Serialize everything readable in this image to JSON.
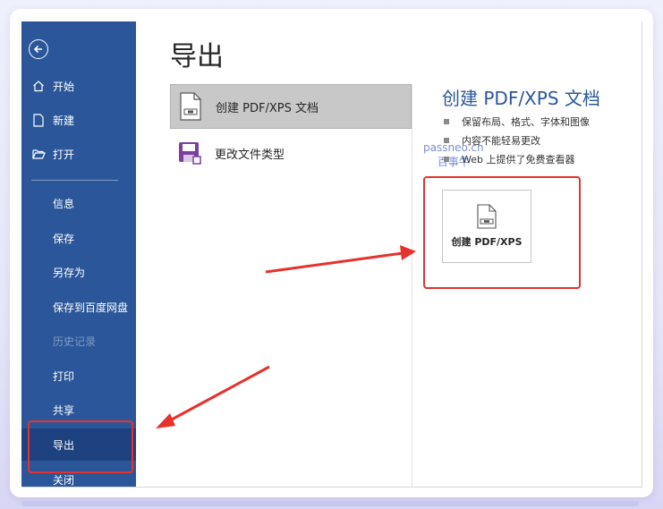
{
  "sidebar": {
    "back_icon": "arrow-left-circle-icon",
    "items": [
      {
        "label": "开始",
        "icon": "home-icon"
      },
      {
        "label": "新建",
        "icon": "new-document-icon"
      },
      {
        "label": "打开",
        "icon": "folder-open-icon"
      },
      {
        "label": "信息"
      },
      {
        "label": "保存"
      },
      {
        "label": "另存为"
      },
      {
        "label": "保存到百度网盘"
      },
      {
        "label": "历史记录"
      },
      {
        "label": "打印"
      },
      {
        "label": "共享"
      },
      {
        "label": "导出"
      },
      {
        "label": "关闭"
      }
    ]
  },
  "main": {
    "title": "导出",
    "options": [
      {
        "label": "创建 PDF/XPS 文档",
        "icon": "pdf-document-icon"
      },
      {
        "label": "更改文件类型",
        "icon": "save-as-filetype-icon"
      }
    ],
    "detail": {
      "title": "创建 PDF/XPS 文档",
      "bullets": [
        "保留布局、格式、字体和图像",
        "内容不能轻易更改",
        "Web 上提供了免费查看器"
      ],
      "button_label": "创建 PDF/XPS"
    }
  },
  "watermark": {
    "line1": "passneo.cn",
    "line2": "百事牛"
  },
  "colors": {
    "sidebar": "#2b579a",
    "sidebar_active": "#1e4280",
    "accent_title": "#2b579a",
    "annotation": "#e5322d"
  }
}
